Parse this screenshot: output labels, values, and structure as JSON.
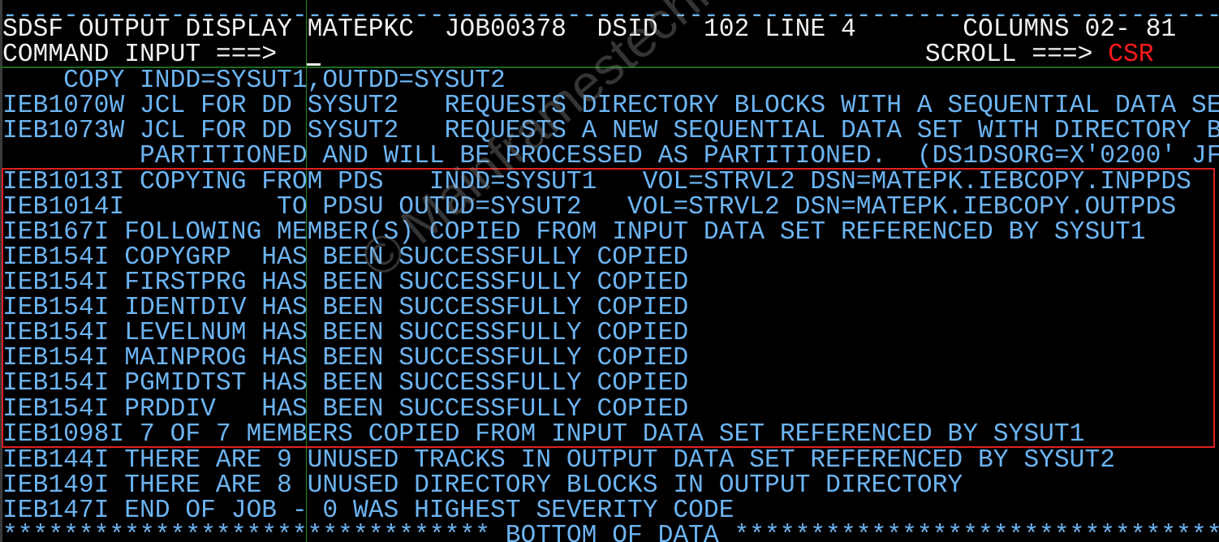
{
  "app": "SDSF",
  "header": {
    "dashes": "--------------------------------------------------------------------------------",
    "title": "SDSF OUTPUT DISPLAY",
    "jobname": "MATEPKC",
    "jobid": "JOB00378",
    "dsid_label": "DSID",
    "dsid_value": "102",
    "line_label": "LINE",
    "line_value": "4",
    "columns_label": "COLUMNS",
    "columns_value": "02- 81",
    "command_label": "COMMAND INPUT ===>",
    "command_value": "",
    "scroll_label": "SCROLL ===>",
    "scroll_value": "CSR"
  },
  "colors": {
    "background": "#000000",
    "text_output": "#6cb4f2",
    "text_header": "#f2f2f2",
    "scroll_value": "#ff1a1a",
    "highlight_box": "#e02020",
    "separator": "#1d6b1d"
  },
  "output_lines": [
    "    COPY INDD=SYSUT1,OUTDD=SYSUT2",
    "IEB1070W JCL FOR DD SYSUT2   REQUESTS DIRECTORY BLOCKS WITH A SEQUENTIAL DATA SE",
    "IEB1073W JCL FOR DD SYSUT2   REQUESTS A NEW SEQUENTIAL DATA SET WITH DIRECTORY B",
    "         PARTITIONED AND WILL BE PROCESSED AS PARTITIONED.  (DS1DSORG=X'0200' JF",
    "IEB1013I COPYING FROM PDS   INDD=SYSUT1   VOL=STRVL2 DSN=MATEPK.IEBCOPY.INPPDS",
    "IEB1014I          TO PDSU OUTDD=SYSUT2   VOL=STRVL2 DSN=MATEPK.IEBCOPY.OUTPDS",
    "IEB167I FOLLOWING MEMBER(S) COPIED FROM INPUT DATA SET REFERENCED BY SYSUT1",
    "IEB154I COPYGRP  HAS BEEN SUCCESSFULLY COPIED",
    "IEB154I FIRSTPRG HAS BEEN SUCCESSFULLY COPIED",
    "IEB154I IDENTDIV HAS BEEN SUCCESSFULLY COPIED",
    "IEB154I LEVELNUM HAS BEEN SUCCESSFULLY COPIED",
    "IEB154I MAINPROG HAS BEEN SUCCESSFULLY COPIED",
    "IEB154I PGMIDTST HAS BEEN SUCCESSFULLY COPIED",
    "IEB154I PRDDIV   HAS BEEN SUCCESSFULLY COPIED",
    "IEB1098I 7 OF 7 MEMBERS COPIED FROM INPUT DATA SET REFERENCED BY SYSUT1",
    "IEB144I THERE ARE 9 UNUSED TRACKS IN OUTPUT DATA SET REFERENCED BY SYSUT2",
    "IEB149I THERE ARE 8 UNUSED DIRECTORY BLOCKS IN OUTPUT DIRECTORY",
    "IEB147I END OF JOB - 0 WAS HIGHEST SEVERITY CODE",
    "******************************** BOTTOM OF DATA ********************************"
  ],
  "watermark": "© Mainframestechhelp"
}
